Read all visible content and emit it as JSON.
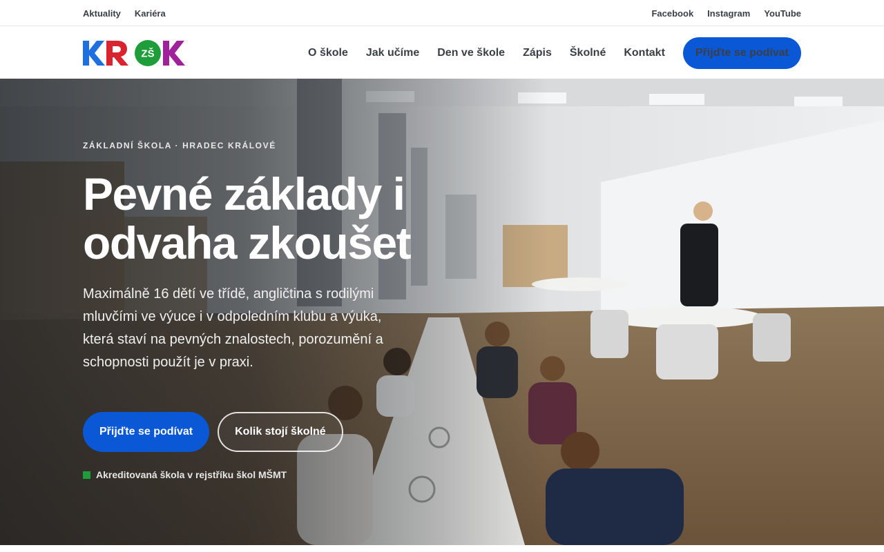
{
  "topbar": {
    "left_links": [
      "Aktuality",
      "Kariéra"
    ],
    "right_links": [
      "Facebook",
      "Instagram",
      "YouTube"
    ]
  },
  "header": {
    "logo": {
      "letters": [
        "K",
        "R",
        "ZŠ",
        "K"
      ],
      "colors": [
        "#1f6fe0",
        "#d9232e",
        "#1f9d3a",
        "#8a2a8c"
      ]
    },
    "nav": [
      "O škole",
      "Jak učíme",
      "Den ve škole",
      "Zápis",
      "Školné",
      "Kontakt"
    ],
    "cta_label": "Přijďte se podívat"
  },
  "hero": {
    "eyebrow": "ZÁKLADNÍ ŠKOLA · HRADEC KRÁLOVÉ",
    "headline": "Pevné základy i odvaha zkoušet",
    "lead": "Maximálně 16 dětí ve třídě, angličtina s rodilými mluvčími ve výuce i v odpoledním klubu a výuka, která staví na pevných znalostech, porozumění a schopnosti použít je v praxi.",
    "primary_button": "Přijďte se podívat",
    "secondary_button": "Kolik stojí školné",
    "accreditation": "Akreditovaná škola v rejstříku škol MŠMT"
  },
  "colors": {
    "accent_blue": "#0a58d6",
    "accreditation_green": "#1f9d3a"
  }
}
